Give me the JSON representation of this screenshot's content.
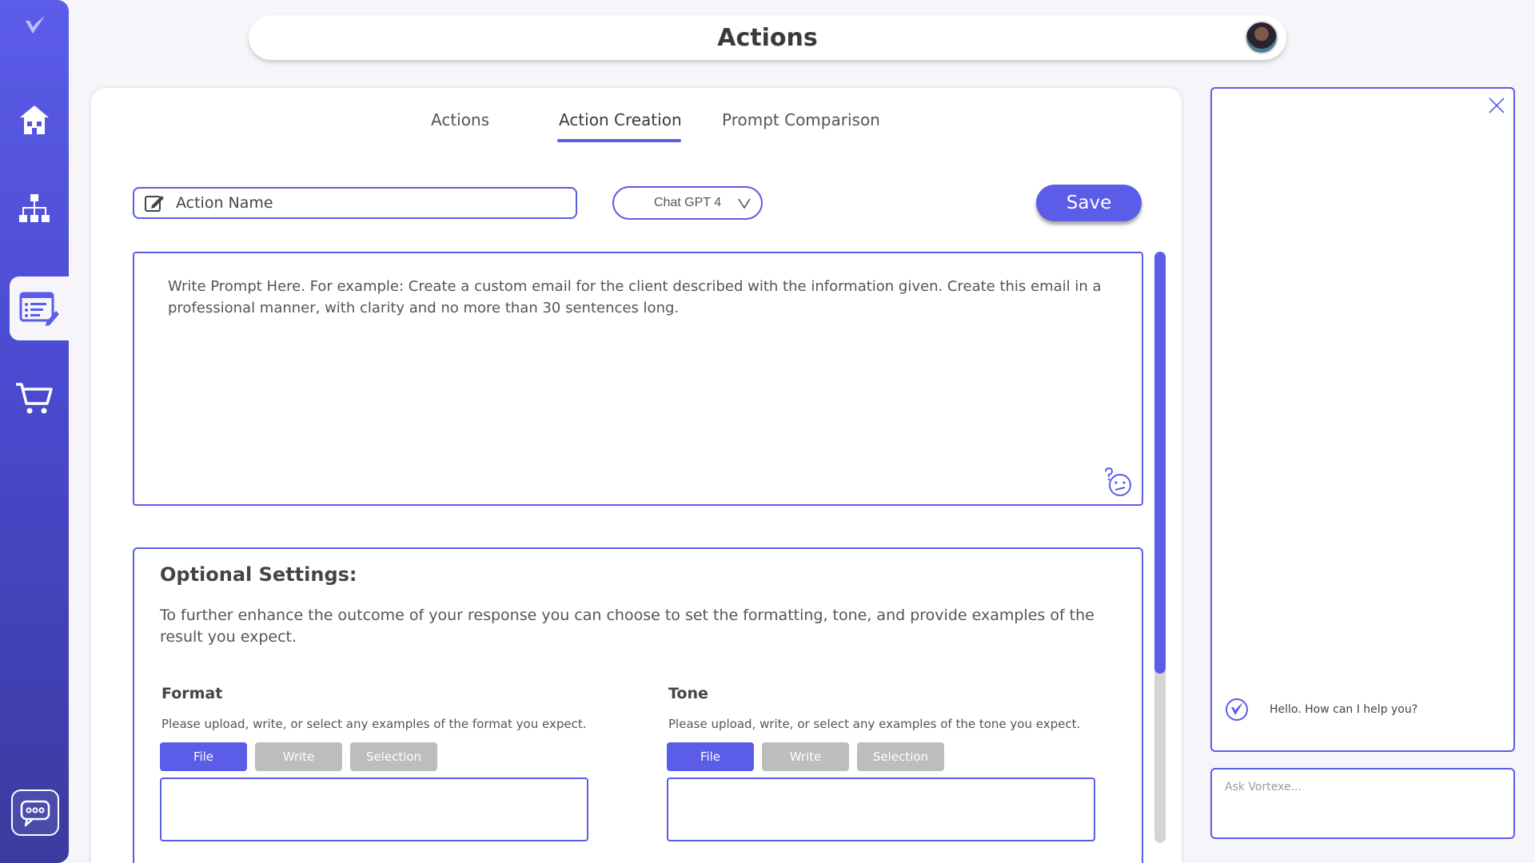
{
  "header": {
    "title": "Actions"
  },
  "sidebar": {
    "items": [
      {
        "name": "home",
        "icon": "home-icon"
      },
      {
        "name": "organization",
        "icon": "org-chart-icon"
      },
      {
        "name": "actions",
        "icon": "actions-edit-icon",
        "active": true
      },
      {
        "name": "cart",
        "icon": "cart-icon"
      }
    ],
    "bottom_icon": "chat-bubble-icon"
  },
  "tabs": [
    {
      "label": "Actions"
    },
    {
      "label": "Action Creation",
      "active": true
    },
    {
      "label": "Prompt Comparison"
    }
  ],
  "form": {
    "name_placeholder": "Action Name",
    "model": "Chat GPT 4",
    "save_label": "Save",
    "prompt_placeholder": "Write Prompt Here. For example: Create a custom email for the client described with the information given. Create this email in a professional manner, with clarity and no more than 30 sentences long."
  },
  "optional": {
    "title": "Optional Settings:",
    "description": "To further enhance the outcome of your response you can choose to set the formatting, tone, and provide examples of the result you expect.",
    "format": {
      "title": "Format",
      "description": "Please upload, write, or select any examples of the format you expect.",
      "options": [
        "File",
        "Write",
        "Selection"
      ],
      "selected": "File"
    },
    "tone": {
      "title": "Tone",
      "description": "Please upload, write, or select any examples of the tone you expect.",
      "options": [
        "File",
        "Write",
        "Selection"
      ],
      "selected": "File"
    }
  },
  "chat": {
    "message": "Hello. How can I help you?",
    "input_placeholder": "Ask Vortexe..."
  },
  "colors": {
    "accent": "#5b5ce8",
    "inactive": "#bdbdbd"
  }
}
